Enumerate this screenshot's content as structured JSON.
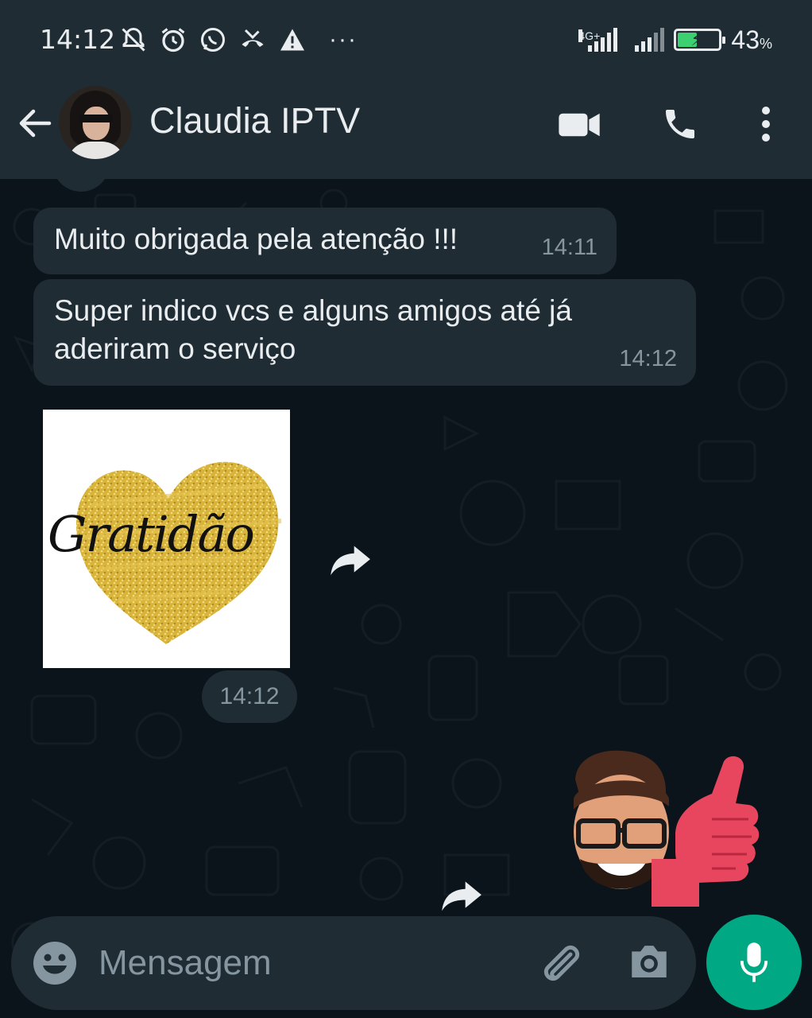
{
  "status_bar": {
    "time": "14:12",
    "network_label": "4G+",
    "battery_percent": "43",
    "battery_unit": "%",
    "battery_level": 0.43,
    "more_indicator": "···"
  },
  "header": {
    "contact_name": "Claudia IPTV"
  },
  "messages": [
    {
      "text": "Muito obrigada pela atenção !!!",
      "time": "14:11"
    },
    {
      "text": "Super indico vcs e alguns amigos até já aderiram o serviço",
      "time": "14:12"
    }
  ],
  "sticker_gratidao": {
    "text": "Gratidão",
    "time": "14:12"
  },
  "composer": {
    "placeholder": "Mensagem"
  },
  "colors": {
    "header_bg": "#1f2c34",
    "chat_bg": "#0b141a",
    "incoming_bubble": "#1f2c34",
    "meta_text": "#8696a0",
    "accent": "#00a884"
  },
  "icons": [
    "back-arrow-icon",
    "video-call-icon",
    "voice-call-icon",
    "more-options-icon",
    "forward-icon",
    "emoji-icon",
    "attach-icon",
    "camera-icon",
    "mic-icon"
  ]
}
